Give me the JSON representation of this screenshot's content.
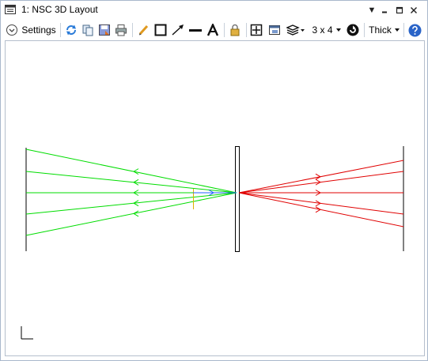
{
  "window": {
    "title": "1: NSC 3D Layout"
  },
  "title_buttons": [
    "dropdown-icon",
    "pin-icon",
    "maximize-icon",
    "close-icon"
  ],
  "toolbar": {
    "settings_label": "Settings",
    "grid_label": "3 x 4",
    "thickness_label": "Thick"
  },
  "colors": {
    "rays_left": "#00dd00",
    "rays_right": "#e00000",
    "ray_blue": "#2060ff",
    "detector_yellow": "#e0b000",
    "frame": "#a9b8cc"
  }
}
